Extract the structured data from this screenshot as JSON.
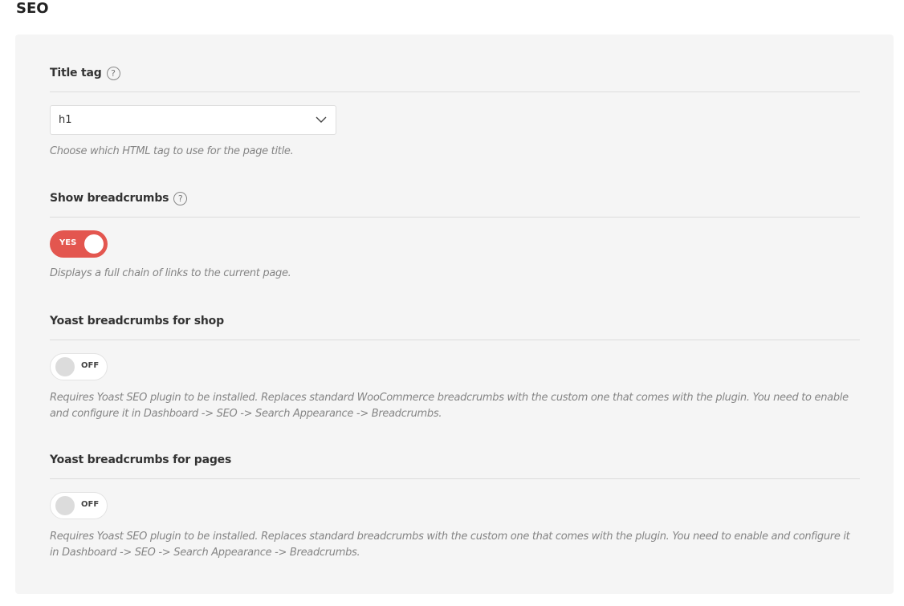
{
  "page": {
    "title": "SEO"
  },
  "fields": {
    "title_tag": {
      "label": "Title tag",
      "help": "?",
      "value": "h1",
      "description": "Choose which HTML tag to use for the page title."
    },
    "show_breadcrumbs": {
      "label": "Show breadcrumbs",
      "help": "?",
      "state": "YES",
      "description": "Displays a full chain of links to the current page."
    },
    "yoast_shop": {
      "label": "Yoast breadcrumbs for shop",
      "state": "OFF",
      "description": "Requires Yoast SEO plugin to be installed. Replaces standard WooCommerce breadcrumbs with the custom one that comes with the plugin. You need to enable and configure it in Dashboard -> SEO -> Search Appearance -> Breadcrumbs."
    },
    "yoast_pages": {
      "label": "Yoast breadcrumbs for pages",
      "state": "OFF",
      "description": "Requires Yoast SEO plugin to be installed. Replaces standard breadcrumbs with the custom one that comes with the plugin. You need to enable and configure it in Dashboard -> SEO -> Search Appearance -> Breadcrumbs."
    }
  },
  "colors": {
    "toggle_on": "#e3564f",
    "panel_bg": "#f5f5f5"
  },
  "icons": {
    "help": "question-circle-icon",
    "dropdown": "chevron-down-icon"
  }
}
